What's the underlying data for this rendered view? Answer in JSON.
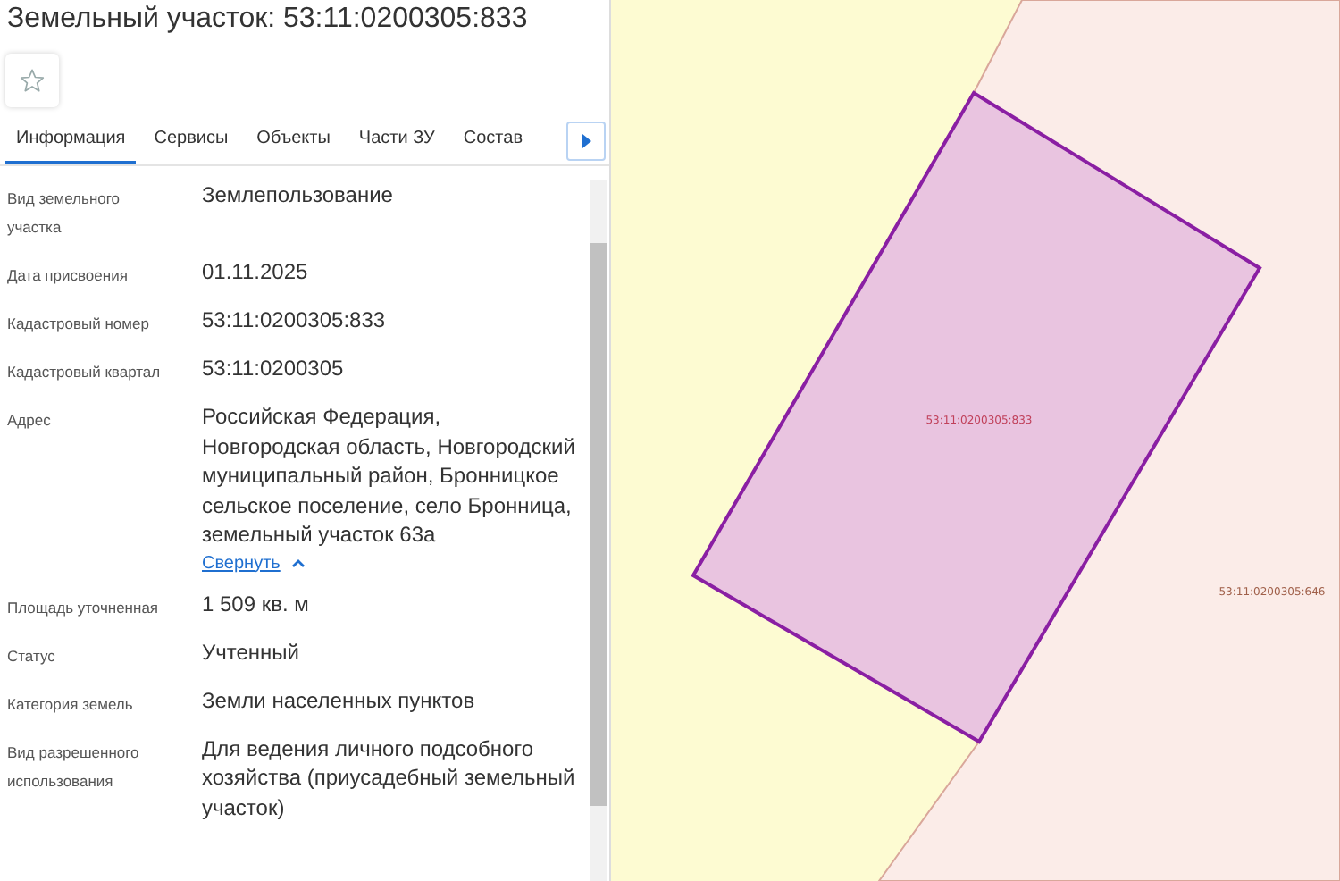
{
  "title": "Земельный участок: 53:11:0200305:833",
  "favorite": {
    "starred": false
  },
  "tabs": [
    {
      "label": "Информация",
      "selected": true
    },
    {
      "label": "Сервисы",
      "selected": false
    },
    {
      "label": "Объекты",
      "selected": false
    },
    {
      "label": "Части ЗУ",
      "selected": false
    },
    {
      "label": "Состав",
      "selected": false
    }
  ],
  "fields": [
    {
      "label": "Вид земельного участка",
      "value": "Землепользование"
    },
    {
      "label": "Дата присвоения",
      "value": "01.11.2025"
    },
    {
      "label": "Кадастровый номер",
      "value": "53:11:0200305:833"
    },
    {
      "label": "Кадастровый квартал",
      "value": "53:11:0200305"
    },
    {
      "label": "Адрес",
      "value": "Российская Федерация, Новгородская область, Новгородский муниципальный район, Бронницкое сельское поселение, село Бронница, земельный участок 63а",
      "toggle": {
        "label": "Свернуть",
        "expanded": true
      }
    },
    {
      "label": "Площадь уточненная",
      "value": "1 509 кв. м"
    },
    {
      "label": "Статус",
      "value": "Учтенный"
    },
    {
      "label": "Категория земель",
      "value": "Земли населенных пунктов"
    },
    {
      "label": "Вид разрешенного использования",
      "value": "Для ведения личного подсобного хозяйства (приусадебный земельный участок)"
    }
  ],
  "map": {
    "parcels": [
      {
        "label": "53:11:0200305:833",
        "selected": true
      },
      {
        "label": "53:11:0200305:646",
        "selected": false
      }
    ]
  }
}
